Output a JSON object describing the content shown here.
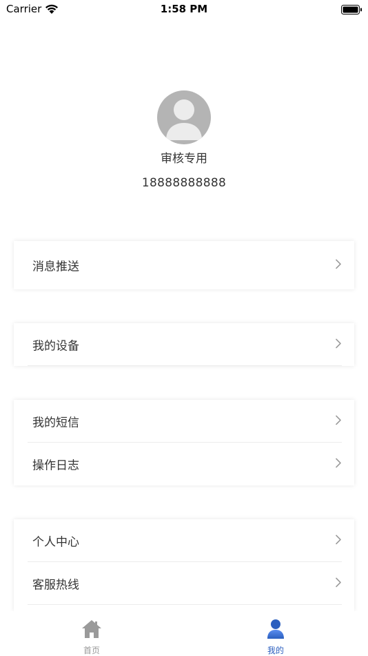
{
  "status_bar": {
    "carrier": "Carrier",
    "time": "1:58 PM"
  },
  "profile": {
    "name": "审核专用",
    "phone": "18888888888"
  },
  "menu": {
    "group1": [
      {
        "label": "消息推送"
      }
    ],
    "group2": [
      {
        "label": "我的设备"
      }
    ],
    "group3": [
      {
        "label": "我的短信"
      },
      {
        "label": "操作日志"
      }
    ],
    "group4": [
      {
        "label": "个人中心"
      },
      {
        "label": "客服热线"
      }
    ]
  },
  "tabs": [
    {
      "label": "首页",
      "icon": "home-icon",
      "active": false
    },
    {
      "label": "我的",
      "icon": "user-icon",
      "active": true
    }
  ],
  "colors": {
    "accent": "#2b5fbf",
    "inactive": "#999999",
    "avatar_bg": "#b4b4b4"
  }
}
